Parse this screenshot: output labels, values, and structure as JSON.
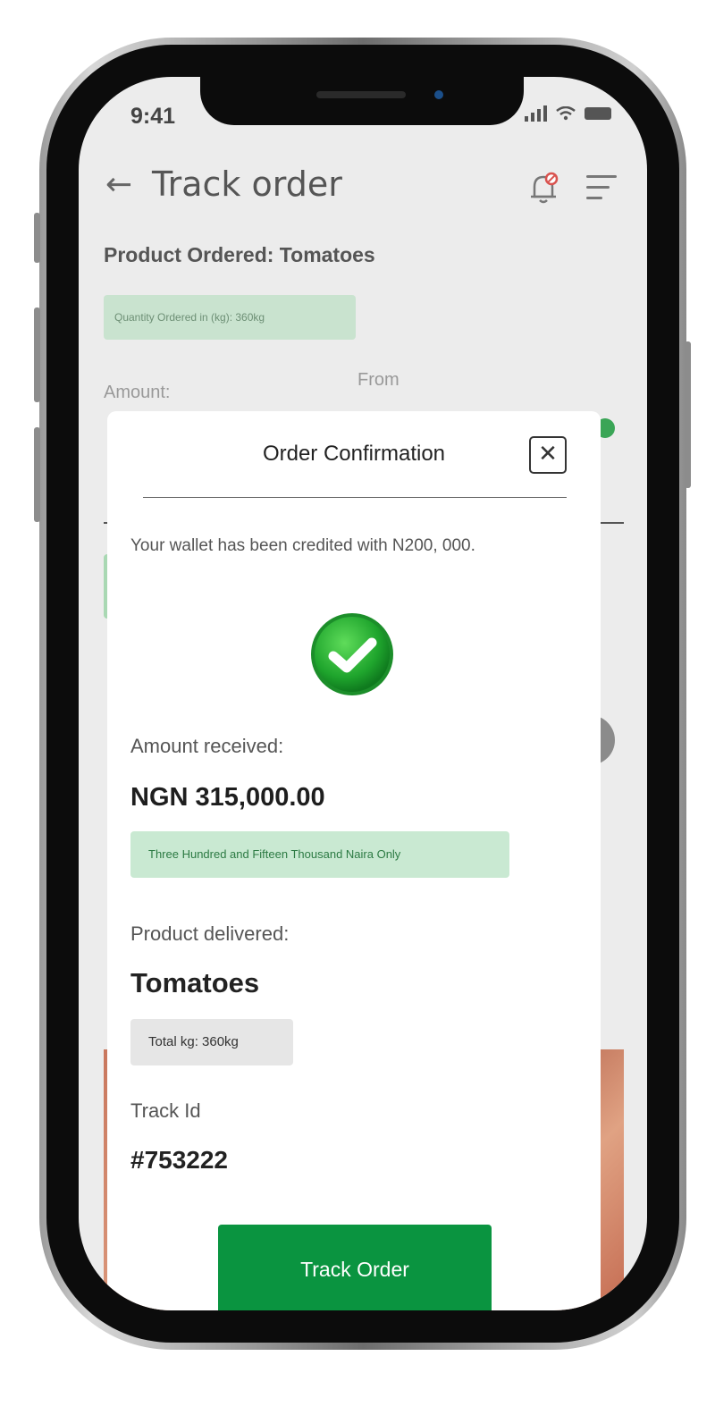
{
  "status_bar": {
    "time": "9:41"
  },
  "header": {
    "title": "Track order"
  },
  "background": {
    "product_ordered": "Product Ordered: Tomatoes",
    "quantity_badge": "Quantity Ordered in (kg): 360kg",
    "amount_label": "Amount:",
    "from_label": "From"
  },
  "modal": {
    "title": "Order Confirmation",
    "message": "Your wallet has been credited with N200, 000.",
    "amount_received_label": "Amount received:",
    "amount_received_value": "NGN 315,000.00",
    "amount_in_words": "Three Hundred and Fifteen Thousand Naira Only",
    "product_delivered_label": "Product delivered:",
    "product_delivered_value": "Tomatoes",
    "total_kg": "Total kg: 360kg",
    "track_id_label": "Track Id",
    "track_id_value": "#753222",
    "track_button": "Track Order"
  },
  "colors": {
    "accent": "#0a9440",
    "success_badge": "#c9e9d2"
  }
}
